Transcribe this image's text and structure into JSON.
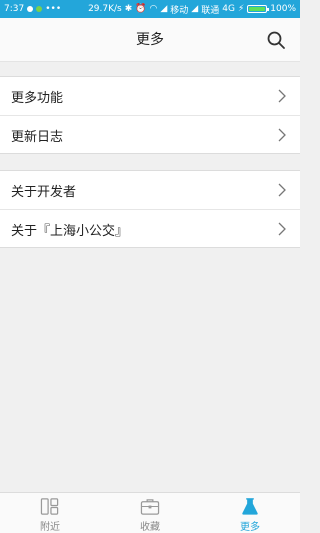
{
  "status_bar": {
    "time": "7:37",
    "speed": "29.7K/s",
    "carrier1": "移动",
    "carrier2": "联通",
    "network": "4G",
    "battery": "100%"
  },
  "header": {
    "title": "更多",
    "search_icon": "search-icon"
  },
  "menu": {
    "group1": [
      {
        "label": "更多功能"
      },
      {
        "label": "更新日志"
      }
    ],
    "group2": [
      {
        "label": "关于开发者"
      },
      {
        "label": "关于『上海小公交』"
      }
    ]
  },
  "tabs": [
    {
      "label": "附近",
      "icon": "nearby-grid-icon",
      "active": false
    },
    {
      "label": "收藏",
      "icon": "briefcase-icon",
      "active": false
    },
    {
      "label": "更多",
      "icon": "flask-icon",
      "active": true
    }
  ],
  "colors": {
    "accent": "#23a6da",
    "status_bar": "#23a6da"
  }
}
